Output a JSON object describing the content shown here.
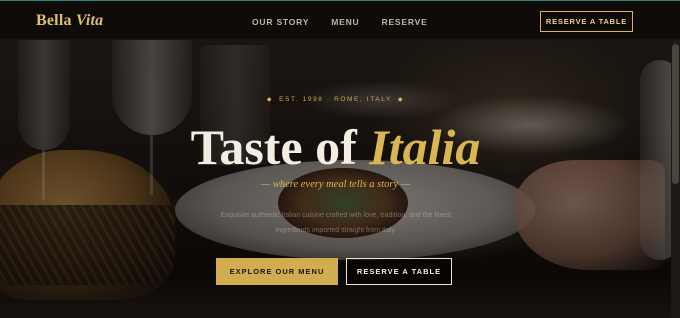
{
  "brand": {
    "name_regular": "Bella",
    "name_italic": "Vita"
  },
  "nav": {
    "links": [
      "OUR STORY",
      "MENU",
      "RESERVE"
    ],
    "cta_label": "RESERVE A TABLE"
  },
  "hero": {
    "eyebrow": "EST. 1998 · ROME, ITALY",
    "headline_main": "Taste of",
    "headline_accent": "Italia",
    "tagline": "— where every meal tells a story —",
    "description": "Exquisite authentic Italian cuisine crafted with love, tradition, and the finest ingredients imported straight from Italy.",
    "primary_button": "EXPLORE OUR MENU",
    "secondary_button": "RESERVE A TABLE"
  },
  "colors": {
    "gold": "#d9b654",
    "nav_background": "#0e0b08",
    "headline": "#f3ece0"
  }
}
